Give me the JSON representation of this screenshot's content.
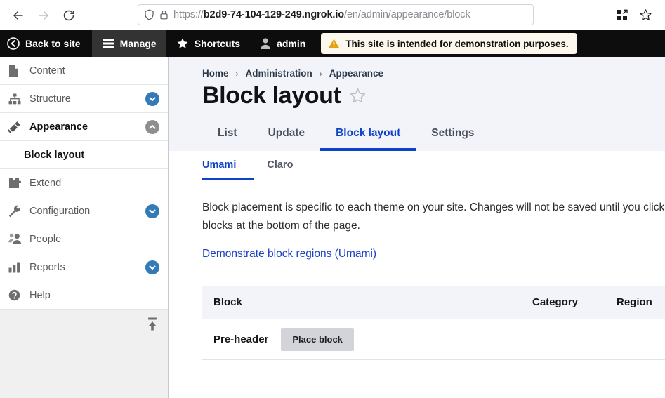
{
  "browser": {
    "back_label": "Back",
    "forward_label": "Forward",
    "reload_label": "Reload",
    "url_scheme": "https://",
    "url_host": "b2d9-74-104-129-249.ngrok.io",
    "url_path": "/en/admin/appearance/block",
    "shield_icon": "shield-icon",
    "lock_icon": "lock-icon",
    "extensions_icon": "extensions-grid-icon",
    "bookmark_icon": "star-outline-icon"
  },
  "toolbar": {
    "back_to_site": "Back to site",
    "manage": "Manage",
    "shortcuts": "Shortcuts",
    "account": "admin",
    "demo_message": "This site is intended for demonstration purposes.",
    "warning_icon": "warning-triangle-icon",
    "back_icon": "circle-chevron-left-icon",
    "manage_icon": "hamburger-icon",
    "shortcuts_icon": "star-filled-icon",
    "account_icon": "person-icon"
  },
  "sidebar": {
    "items": [
      {
        "label": "Content",
        "icon": "file-icon",
        "expandable": false,
        "active": false
      },
      {
        "label": "Structure",
        "icon": "sitemap-icon",
        "expandable": true,
        "active": false,
        "chevron": "chevron-down-icon"
      },
      {
        "label": "Appearance",
        "icon": "paintbrush-icon",
        "expandable": true,
        "active": true,
        "chevron": "chevron-up-icon"
      },
      {
        "label": "Extend",
        "icon": "puzzle-icon",
        "expandable": false,
        "active": false
      },
      {
        "label": "Configuration",
        "icon": "wrench-icon",
        "expandable": true,
        "active": false,
        "chevron": "chevron-down-icon"
      },
      {
        "label": "People",
        "icon": "people-icon",
        "expandable": false,
        "active": false
      },
      {
        "label": "Reports",
        "icon": "bar-chart-icon",
        "expandable": true,
        "active": false,
        "chevron": "chevron-down-icon"
      },
      {
        "label": "Help",
        "icon": "question-circle-icon",
        "expandable": false,
        "active": false
      }
    ],
    "subitem": "Block layout",
    "toggle_icon": "dock-to-top-icon",
    "accent_color": "#337ab7",
    "accent_grey": "#8e8e8e"
  },
  "breadcrumb": {
    "items": [
      "Home",
      "Administration",
      "Appearance"
    ],
    "separator": "›"
  },
  "header": {
    "title": "Block layout",
    "star_icon": "star-outline-icon"
  },
  "primary_tabs": [
    {
      "label": "List",
      "active": false
    },
    {
      "label": "Update",
      "active": false
    },
    {
      "label": "Block layout",
      "active": true
    },
    {
      "label": "Settings",
      "active": false
    }
  ],
  "secondary_tabs": [
    {
      "label": "Umami",
      "active": true
    },
    {
      "label": "Claro",
      "active": false
    }
  ],
  "content": {
    "intro": "Block placement is specific to each theme on your site. Changes will not be saved until you click Save blocks at the bottom of the page.",
    "demo_link": "Demonstrate block regions (Umami)"
  },
  "block_table": {
    "columns": [
      "Block",
      "Category",
      "Region"
    ],
    "rows": [
      {
        "label": "Pre-header",
        "button": "Place block"
      }
    ]
  },
  "colors": {
    "accent_blue": "#0d42c9",
    "link_blue": "#1a42c4",
    "header_bg": "#f3f4f9",
    "toolbar_bg": "#0d0d0d",
    "warning_bg": "#fdf8ed",
    "warning_icon": "#e5a00d"
  }
}
